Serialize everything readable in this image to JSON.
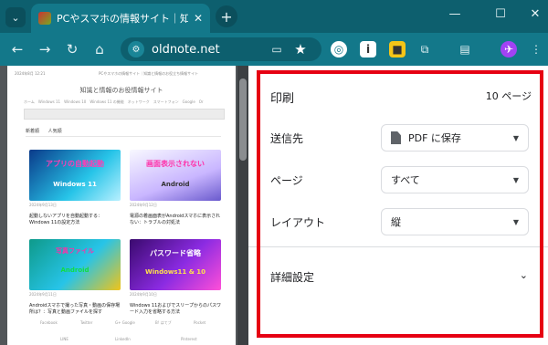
{
  "browser": {
    "tab_title": "PCやスマホの情報サイト｜知識と情報",
    "tab_close": "✕",
    "new_tab": "+",
    "url": "oldnote.net",
    "window_controls": [
      "—",
      "☐",
      "✕"
    ]
  },
  "preview": {
    "header_left": "2024年8月 12:21",
    "header_center": "PCやスマホの情報サイト｜知識と情報のお役立ち情報サイト",
    "brand": "知識と情報のお役情報サイト",
    "nav": "ホーム　Windows 11　Windows 10　Windows 11 の機能　ネットワーク　スマートフォン　Google　Or",
    "tabs": [
      "新着順",
      "人気順"
    ],
    "cards": [
      {
        "overlay": "アプリの自動起動",
        "overlay2": "Windows 11",
        "date": "2024年9月13日",
        "title": "起動しないアプリを自動起動する：Windows 11の設定方法"
      },
      {
        "overlay": "画面表示されない",
        "overlay2": "Android",
        "date": "2024年9月12日",
        "title": "電源の着画面表がAndroidスマホに表示されない：トラブルの対処法"
      },
      {
        "overlay": "写真ファイル",
        "overlay2": "Android",
        "date": "2024年9月11日",
        "title": "Androidスマホで撮った写真・動画の保存場所は？：写真と動画ファイルを探す"
      },
      {
        "overlay": "パスワード省略",
        "overlay2": "Windows11 & 10",
        "date": "2024年9月10日",
        "title": "Windows 11およびでスリープからのパスワード入力を省略する方法"
      }
    ],
    "share_row1": [
      "Facebook",
      "Twitter",
      "G+ Google",
      "B! はてブ",
      "Pocket"
    ],
    "share_row2": [
      "LINE",
      "LinkedIn",
      "Pinterest"
    ]
  },
  "dialog": {
    "title": "印刷",
    "page_count": "10 ページ",
    "destination_label": "送信先",
    "destination_value": "PDF に保存",
    "pages_label": "ページ",
    "pages_value": "すべて",
    "layout_label": "レイアウト",
    "layout_value": "縦",
    "advanced_label": "詳細設定"
  },
  "colors": {
    "tabbar": "#0d5f6e",
    "toolbar": "#13788a",
    "highlight": "#e60012"
  }
}
